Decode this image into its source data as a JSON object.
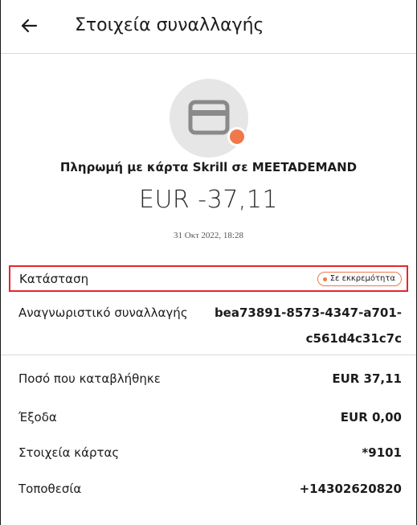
{
  "header": {
    "title": "Στοιχεία συναλλαγής",
    "back_icon": "arrow-left-icon"
  },
  "summary": {
    "icon": "credit-card-icon",
    "status_dot_color": "#f0784a",
    "description": "Πληρωμή με κάρτα Skrill σε MEETADEMAND",
    "amount": "EUR -37,11",
    "date": "31 Οκτ 2022, 18:28"
  },
  "status": {
    "label": "Κατάσταση",
    "badge": "Σε εκκρεμότητα",
    "badge_color": "#f0784a"
  },
  "transaction_id": {
    "label": "Αναγνωριστικό συναλλαγής",
    "value": "bea73891-8573-4347-a701-c561d4c31c7c"
  },
  "details": [
    {
      "label": "Ποσό που καταβλήθηκε",
      "value": "EUR 37,11"
    },
    {
      "label": "Έξοδα",
      "value": "EUR 0,00"
    },
    {
      "label": "Στοιχεία κάρτας",
      "value": "*9101"
    },
    {
      "label": "Τοποθεσία",
      "value": "+14302620820"
    }
  ]
}
